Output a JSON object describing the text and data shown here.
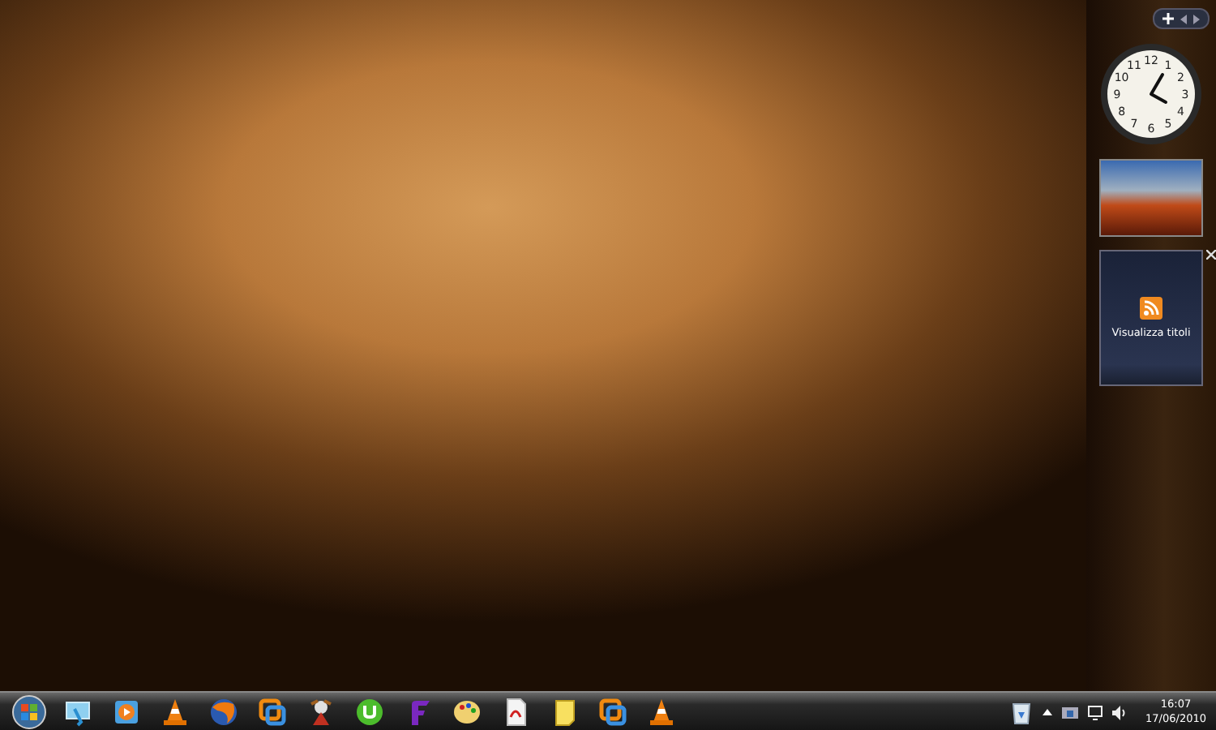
{
  "gadgets": {
    "clock": {
      "numerals": [
        "12",
        "11",
        "1",
        "10",
        "2",
        "9",
        "3",
        "8",
        "4",
        "7",
        "5",
        "6"
      ]
    },
    "feed": {
      "label": "Visualizza titoli"
    }
  },
  "tray": {
    "time": "16:07",
    "date": "17/06/2010"
  }
}
